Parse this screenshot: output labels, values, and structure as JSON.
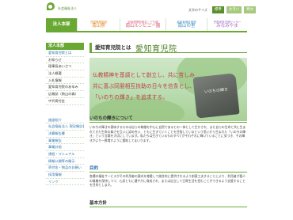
{
  "header": {
    "org_sub": "社会福祉法人",
    "org_name": "愛知育児院",
    "font_size_label": "文字のサイズ",
    "font_sizes": [
      "標準",
      "大きい",
      "特大"
    ]
  },
  "nav": {
    "items": [
      {
        "sub": "",
        "label": "法人本部"
      },
      {
        "sub": "児童養護施設",
        "label": "南山寮"
      },
      {
        "sub": "幼保連携型認定こども園",
        "label": "南山ルンビニー園"
      },
      {
        "sub": "高齢者福祉施設",
        "label": "南山の里"
      },
      {
        "sub": "児童家庭支援センター",
        "label": "みなみやま"
      }
    ]
  },
  "sidebar": {
    "heading": "法人本部",
    "items": [
      {
        "label": "愛知育児院とは"
      },
      {
        "label": "お知らせ"
      },
      {
        "label": "理事長あいさつ"
      },
      {
        "label": "法人概要"
      },
      {
        "label": "入札情報"
      },
      {
        "label": "愛知育児院のあゆみ"
      },
      {
        "label": "広報誌（南山の森）"
      },
      {
        "label": "中代寄付金"
      }
    ],
    "links": [
      {
        "label": "施設紹介"
      },
      {
        "label": "社会福祉法人 現況報告書"
      },
      {
        "label": "決算報告書"
      },
      {
        "label": "事業報告"
      },
      {
        "label": "事業計画"
      },
      {
        "label": "規程・マニュアル"
      },
      {
        "label": "情報公開等の開示"
      },
      {
        "label": "寄付金・物品のお願い"
      },
      {
        "label": "採用情報"
      },
      {
        "label": "リンク"
      }
    ]
  },
  "main": {
    "title": "愛知育児院とは",
    "hero_lines": [
      "仏教精神を基調として創立し、共に苦しみ",
      "共に喜ぶ同朋相互扶助の日々を信条とし、",
      "「いのちの輝き」を追求する。"
    ],
    "stone_text": "いのちの輝き",
    "section1": {
      "heading": "いのちの輝きについて",
      "text": "いのちの輝きの意味するものは自らの尊厳を中心に自然であるとの一体として生かされ、また自らの生命と共に生まれてきた生命の尊さを互いに認め合い、ともに生きていくことを目指しているという思いから生まれた「いのちの輝き」という言葉を大切にしています。私たちは生きているものすべてがそれぞれに輝いていることに気づき、その輝きがより一層増すように援助してまいります。"
    },
    "section2": {
      "heading": "目的",
      "text": "各種の福祉サービスがその利用者の意向を尊重して総合的に提供されるよう創意工夫することにより、利用者が個人の尊厳を保持しつつ、心身ともに健やかに育成され、または自立して日常生活を営むことができるよう支援することを目的とします。"
    },
    "section3": {
      "heading": "基本方針"
    }
  },
  "colors": {
    "brand_green": "#6aa834",
    "hero_text_red": "#c0393b"
  }
}
